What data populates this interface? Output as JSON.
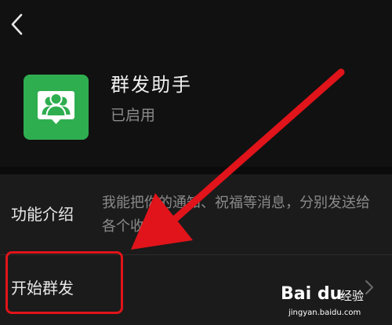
{
  "app": {
    "name": "群发助手",
    "status": "已启用",
    "icon": "group-users-chat-icon",
    "icon_color": "#2fae50"
  },
  "rows": {
    "intro_label": "功能介绍",
    "intro_text": "我能把你的通知、祝福等消息，分别发送给各个收件人",
    "start_label": "开始群发"
  },
  "annotation": {
    "color": "#e0141a"
  },
  "watermark": {
    "logo": "Bai du",
    "jingyan": "经验",
    "url": "jingyan.baidu.com"
  }
}
